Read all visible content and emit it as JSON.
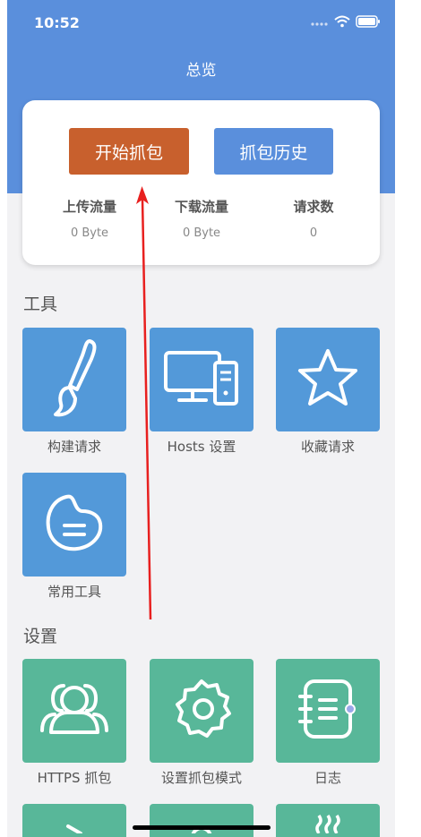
{
  "status": {
    "time": "10:52"
  },
  "nav": {
    "title": "总览"
  },
  "card": {
    "start_button": "开始抓包",
    "history_button": "抓包历史",
    "stats": [
      {
        "label": "上传流量",
        "value": "0 Byte"
      },
      {
        "label": "下载流量",
        "value": "0 Byte"
      },
      {
        "label": "请求数",
        "value": "0"
      }
    ]
  },
  "tools": {
    "title": "工具",
    "items": [
      {
        "label": "构建请求",
        "icon": "paintbrush-icon"
      },
      {
        "label": "Hosts 设置",
        "icon": "desktop-computer-icon"
      },
      {
        "label": "收藏请求",
        "icon": "star-icon"
      },
      {
        "label": "常用工具",
        "icon": "tools-blob-icon"
      }
    ]
  },
  "settings": {
    "title": "设置",
    "items": [
      {
        "label": "HTTPS 抓包",
        "icon": "users-icon"
      },
      {
        "label": "设置抓包模式",
        "icon": "gear-icon"
      },
      {
        "label": "日志",
        "icon": "notebook-icon"
      }
    ]
  },
  "colors": {
    "header_blue": "#5a8fdc",
    "start_orange": "#c8602d",
    "tool_tile_blue": "#5399d9",
    "setting_tile_green": "#58b799",
    "annotation_arrow_red": "#e8201f"
  }
}
